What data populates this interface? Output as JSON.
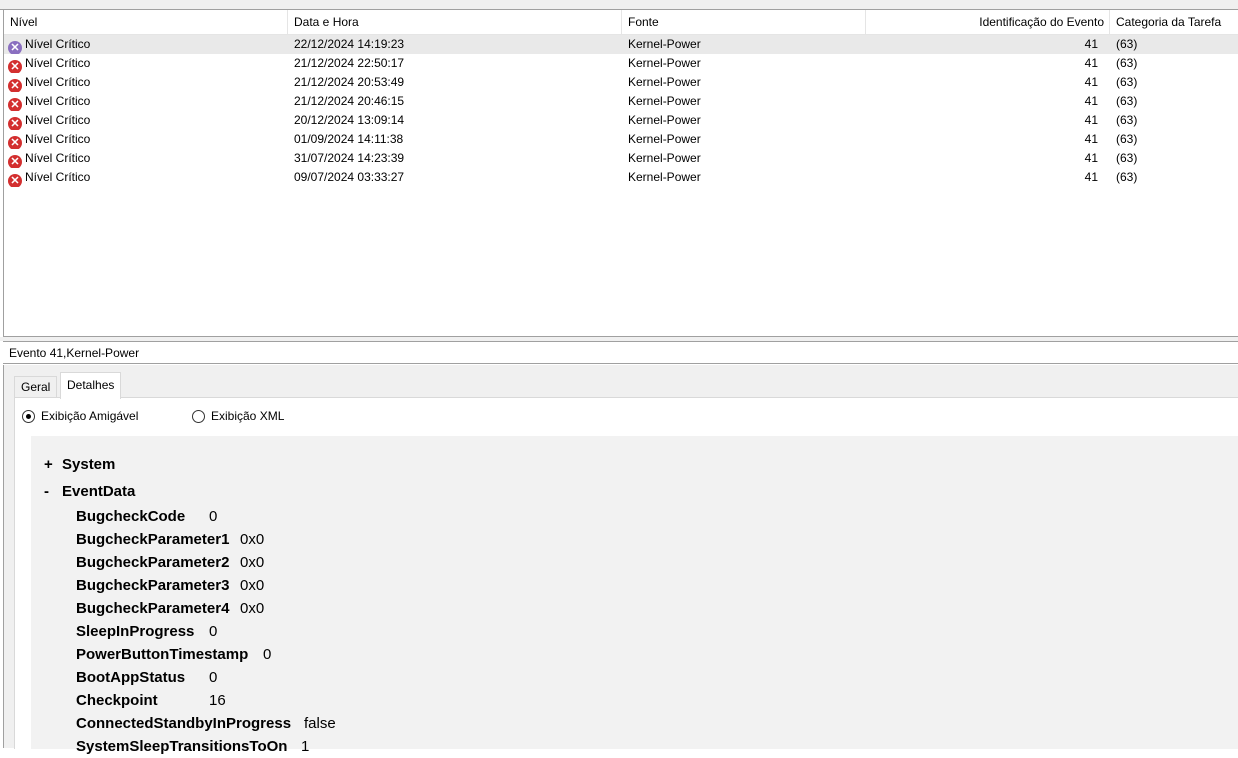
{
  "columns": {
    "level": "Nível",
    "date": "Data e Hora",
    "source": "Fonte",
    "event_id": "Identificação do Evento",
    "task_category": "Categoria da Tarefa"
  },
  "events": [
    {
      "level": "Nível Crítico",
      "date": "22/12/2024 14:19:23",
      "source": "Kernel-Power",
      "event_id": "41",
      "task_category": "(63)"
    },
    {
      "level": "Nível Crítico",
      "date": "21/12/2024 22:50:17",
      "source": "Kernel-Power",
      "event_id": "41",
      "task_category": "(63)"
    },
    {
      "level": "Nível Crítico",
      "date": "21/12/2024 20:53:49",
      "source": "Kernel-Power",
      "event_id": "41",
      "task_category": "(63)"
    },
    {
      "level": "Nível Crítico",
      "date": "21/12/2024 20:46:15",
      "source": "Kernel-Power",
      "event_id": "41",
      "task_category": "(63)"
    },
    {
      "level": "Nível Crítico",
      "date": "20/12/2024 13:09:14",
      "source": "Kernel-Power",
      "event_id": "41",
      "task_category": "(63)"
    },
    {
      "level": "Nível Crítico",
      "date": "01/09/2024 14:11:38",
      "source": "Kernel-Power",
      "event_id": "41",
      "task_category": "(63)"
    },
    {
      "level": "Nível Crítico",
      "date": "31/07/2024 14:23:39",
      "source": "Kernel-Power",
      "event_id": "41",
      "task_category": "(63)"
    },
    {
      "level": "Nível Crítico",
      "date": "09/07/2024 03:33:27",
      "source": "Kernel-Power",
      "event_id": "41",
      "task_category": "(63)"
    }
  ],
  "details": {
    "title": "Evento 41,Kernel-Power",
    "tabs": [
      "Geral",
      "Detalhes"
    ],
    "view_friendly": "Exibição Amigável",
    "view_xml": "Exibição XML",
    "tree": [
      {
        "toggle": "+",
        "label": "System"
      },
      {
        "toggle": "-",
        "label": "EventData"
      }
    ],
    "event_data": [
      {
        "key": "BugcheckCode",
        "value": "0"
      },
      {
        "key": "BugcheckParameter1",
        "value": "0x0"
      },
      {
        "key": "BugcheckParameter2",
        "value": "0x0"
      },
      {
        "key": "BugcheckParameter3",
        "value": "0x0"
      },
      {
        "key": "BugcheckParameter4",
        "value": "0x0"
      },
      {
        "key": "SleepInProgress",
        "value": "0"
      },
      {
        "key": "PowerButtonTimestamp",
        "value": "0"
      },
      {
        "key": "BootAppStatus",
        "value": "0"
      },
      {
        "key": "Checkpoint",
        "value": "16"
      },
      {
        "key": "ConnectedStandbyInProgress",
        "value": "false"
      },
      {
        "key": "SystemSleepTransitionsToOn",
        "value": "1"
      }
    ]
  },
  "icons": {
    "critical": "error-circle-icon"
  },
  "colors": {
    "critical": "#d32f2f",
    "selected_row": "#e9e9e9"
  }
}
